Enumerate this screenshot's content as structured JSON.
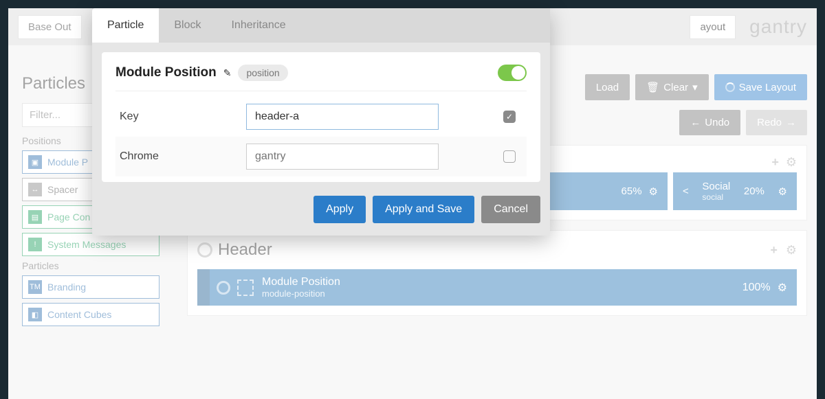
{
  "topbar": {
    "outline": "Base Out",
    "layout_tab": "ayout",
    "brand": "gantry"
  },
  "sidebar": {
    "title": "Particles",
    "filter_placeholder": "Filter...",
    "group_positions": "Positions",
    "group_particles": "Particles",
    "items": {
      "module": "Module P",
      "spacer": "Spacer",
      "page": "Page Con",
      "system": "System Messages",
      "branding": "Branding",
      "content": "Content Cubes"
    }
  },
  "toolbar": {
    "load": "Load",
    "clear": "Clear",
    "save": "Save Layout",
    "undo": "Undo",
    "redo": "Redo"
  },
  "row1": {
    "pct": "65%",
    "social_title": "Social",
    "social_sub": "social",
    "social_pct": "20%"
  },
  "section_header": {
    "title": "Header",
    "module_title": "Module Position",
    "module_sub": "module-position",
    "module_pct": "100%"
  },
  "modal": {
    "tabs": {
      "particle": "Particle",
      "block": "Block",
      "inheritance": "Inheritance"
    },
    "title": "Module Position",
    "badge": "position",
    "fields": {
      "key_label": "Key",
      "key_value": "header-a",
      "chrome_label": "Chrome",
      "chrome_placeholder": "gantry"
    },
    "buttons": {
      "apply": "Apply",
      "apply_save": "Apply and Save",
      "cancel": "Cancel"
    }
  }
}
